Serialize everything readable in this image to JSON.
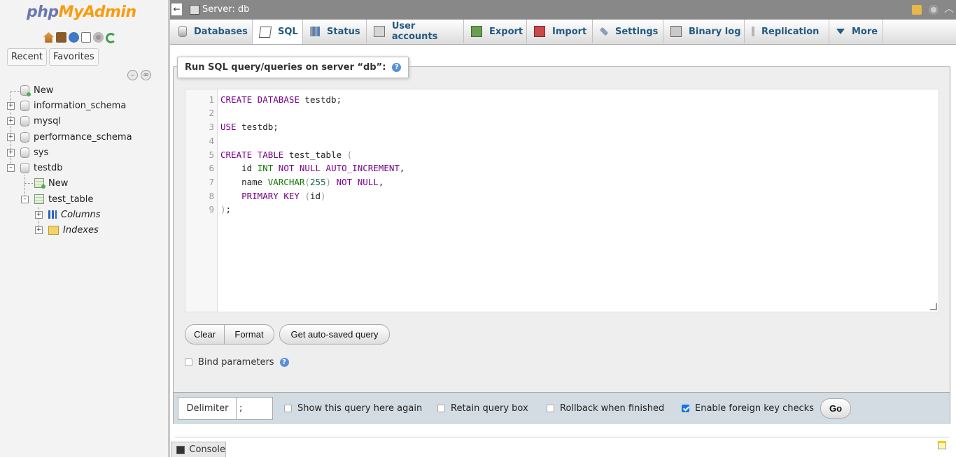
{
  "nav": {
    "logo_php": "php",
    "logo_myadmin": "MyAdmin",
    "icons": [
      "home-icon",
      "exit-icon",
      "help-icon",
      "docs-icon",
      "settings-icon",
      "reload-icon"
    ],
    "tabs": {
      "recent": "Recent",
      "favorites": "Favorites"
    },
    "tree": {
      "new": "New",
      "databases": [
        "information_schema",
        "mysql",
        "performance_schema",
        "sys",
        "testdb"
      ],
      "testdb_children": {
        "new": "New",
        "table": "test_table",
        "columns": "Columns",
        "indexes": "Indexes"
      }
    }
  },
  "topbar": {
    "collapse": "←",
    "server_label": "Server: db"
  },
  "menu": {
    "tabs": [
      "Databases",
      "SQL",
      "Status",
      "User accounts",
      "Export",
      "Import",
      "Settings",
      "Binary log",
      "Replication",
      "More"
    ],
    "active": "SQL"
  },
  "sql_panel": {
    "legend": "Run SQL query/queries on server “db”:",
    "line_numbers": [
      "1",
      "2",
      "3",
      "4",
      "5",
      "6",
      "7",
      "8",
      "9"
    ],
    "code_lines": [
      "CREATE DATABASE testdb;",
      "",
      "USE testdb;",
      "",
      "CREATE TABLE test_table (",
      "    id INT NOT NULL AUTO_INCREMENT,",
      "    name VARCHAR(255) NOT NULL,",
      "    PRIMARY KEY (id)",
      ");"
    ],
    "buttons": {
      "clear": "Clear",
      "format": "Format",
      "autosave": "Get auto-saved query"
    },
    "bind_params": "Bind parameters"
  },
  "footer": {
    "delimiter_label": "Delimiter",
    "delimiter_value": ";",
    "options": {
      "show_query": "Show this query here again",
      "retain_box": "Retain query box",
      "rollback": "Rollback when finished",
      "fk_checks": "Enable foreign key checks"
    },
    "fk_checked": true,
    "go": "Go"
  },
  "console": {
    "label": "Console"
  },
  "colors": {
    "tab_text": "#235a81",
    "topbar": "#888888",
    "logo_php": "#6c78af",
    "logo_myadmin": "#f89c0e"
  }
}
